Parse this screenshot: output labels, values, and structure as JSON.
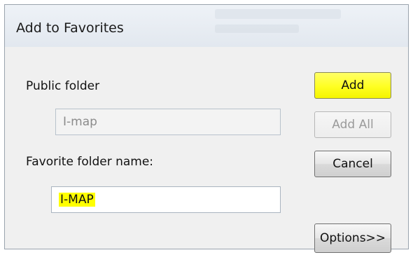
{
  "dialog": {
    "title": "Add to Favorites"
  },
  "form": {
    "public_folder_label": "Public folder",
    "public_folder_value": "I-map",
    "favorite_name_label": "Favorite folder name:",
    "favorite_name_value": "I-MAP"
  },
  "buttons": {
    "add": "Add",
    "add_all": "Add All",
    "cancel": "Cancel",
    "options": "Options>>"
  },
  "colors": {
    "highlight": "#ffff00"
  }
}
